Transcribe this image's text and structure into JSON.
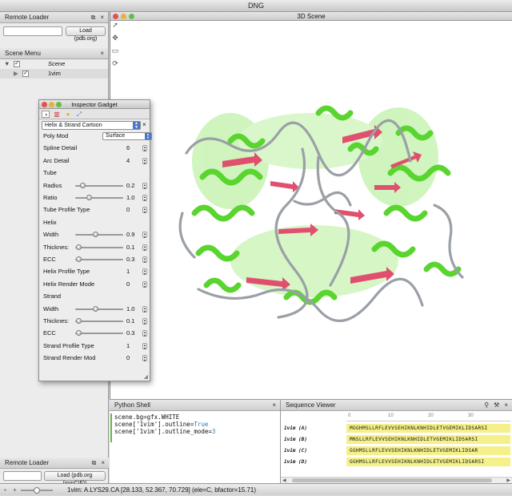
{
  "app": {
    "title": "DNG"
  },
  "remote_loader_top": {
    "title": "Remote Loader",
    "load_button": "Load (pdb.org)",
    "input_value": ""
  },
  "scene_menu": {
    "title": "Scene Menu",
    "items": [
      {
        "label": "Scene"
      },
      {
        "label": "1vim"
      }
    ]
  },
  "scene_3d": {
    "title": "3D Scene"
  },
  "inspector": {
    "title": "Inspector Gadget",
    "render_mode": "Helix & Strand Cartoon",
    "rows": [
      {
        "label": "Poly Mode",
        "display": "Poly Mod",
        "kind": "select",
        "value": "Surface"
      },
      {
        "label": "Spline Detail",
        "kind": "number",
        "value": "6"
      },
      {
        "label": "Arc Detail",
        "kind": "number",
        "value": "4"
      },
      {
        "label": "Tube",
        "kind": "section"
      },
      {
        "label": "Radius",
        "kind": "slider",
        "value": "0.2",
        "pos": 0.12
      },
      {
        "label": "Ratio",
        "kind": "slider",
        "value": "1.0",
        "pos": 0.25
      },
      {
        "label": "Tube Profile Type",
        "kind": "number",
        "value": "0"
      },
      {
        "label": "Helix",
        "kind": "section"
      },
      {
        "label": "Width",
        "kind": "slider",
        "value": "0.9",
        "pos": 0.4
      },
      {
        "label": "Thickness",
        "display": "Thicknes:",
        "kind": "slider",
        "value": "0.1",
        "pos": 0.02
      },
      {
        "label": "ECC",
        "kind": "slider",
        "value": "0.3",
        "pos": 0.02
      },
      {
        "label": "Helix Profile Type",
        "kind": "number",
        "value": "1"
      },
      {
        "label": "Helix Render Mode",
        "kind": "number",
        "value": "0"
      },
      {
        "label": "Strand",
        "kind": "section"
      },
      {
        "label": "Width",
        "kind": "slider",
        "value": "1.0",
        "pos": 0.4
      },
      {
        "label": "Thickness",
        "display": "Thicknes:",
        "kind": "slider",
        "value": "0.1",
        "pos": 0.02
      },
      {
        "label": "ECC",
        "kind": "slider",
        "value": "0.3",
        "pos": 0.02
      },
      {
        "label": "Strand Profile Type",
        "kind": "number",
        "value": "1"
      },
      {
        "label": "Strand Render Mode",
        "display": "Strand Render Mod",
        "kind": "number",
        "value": "0"
      }
    ]
  },
  "python_shell": {
    "title": "Python Shell",
    "lines": [
      [
        {
          "t": "scene.bg=gfx.WHITE",
          "c": "#111"
        }
      ],
      [
        {
          "t": "scene['1vim'].outline=",
          "c": "#111"
        },
        {
          "t": "True",
          "c": "#2a7db5"
        }
      ],
      [
        {
          "t": "scene['1vim'].outline_mode=",
          "c": "#111"
        },
        {
          "t": "3",
          "c": "#2a7db5"
        }
      ]
    ]
  },
  "sequence_viewer": {
    "title": "Sequence Viewer",
    "ruler": [
      "0",
      "10",
      "20",
      "30"
    ],
    "rows": [
      {
        "name": "1vim (A)",
        "seq": "MGGHMSLLRFLEVVSEHIKNLKNHIDLETVGEMIKLIDSARSI"
      },
      {
        "name": "1vim (B)",
        "seq": "MNSLLRFLEVVSEHIKNLKNHIDLETVGEMIKLIDSARSI"
      },
      {
        "name": "1vim (C)",
        "seq": "GGHMSLLRFLEVVSEHIKNLKNHIDLETVGEMIKLIDSAR"
      },
      {
        "name": "1vim (D)",
        "seq": "GGHMSLLRFLEVVSEHIKNLKNHIDLETVGEMIKLIDSARSI"
      }
    ]
  },
  "remote_loader_bottom": {
    "title": "Remote Loader",
    "load_button": "Load (pdb.org (mmCIF))",
    "input_value": ""
  },
  "statusbar": {
    "text": "1vim: A.LYS29.CA [28.133, 52.367, 70.729] (ele=C, bfactor=15.71)"
  },
  "colors": {
    "helix": "#66e03a",
    "strand": "#e0506e",
    "coil": "#9aa0a6",
    "sequence_highlight": "#f5f08a"
  }
}
